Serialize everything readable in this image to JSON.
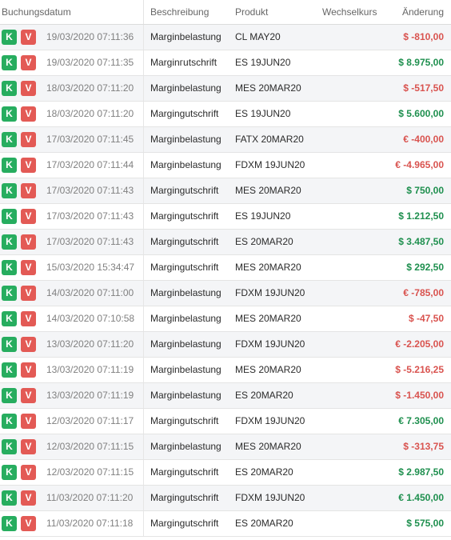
{
  "header": {
    "date": "Buchungsdatum",
    "description": "Beschreibung",
    "product": "Produkt",
    "exchange_rate": "Wechselkurs",
    "change": "Änderung"
  },
  "buttons": {
    "k_label": "K",
    "v_label": "V"
  },
  "colors": {
    "k_button": "#27ad5f",
    "v_button": "#e35a55",
    "negative": "#d9534f",
    "positive": "#1e8f4e"
  },
  "rows": [
    {
      "date": "19/03/2020 07:11:36",
      "description": "Marginbelastung",
      "product": "CL MAY20",
      "rate": "",
      "amount": "$ -810,00",
      "sign": "neg"
    },
    {
      "date": "19/03/2020 07:11:35",
      "description": "Marginгutschrift",
      "product": "ES 19JUN20",
      "rate": "",
      "amount": "$ 8.975,00",
      "sign": "pos"
    },
    {
      "date": "18/03/2020 07:11:20",
      "description": "Marginbelastung",
      "product": "MES 20MAR20",
      "rate": "",
      "amount": "$ -517,50",
      "sign": "neg"
    },
    {
      "date": "18/03/2020 07:11:20",
      "description": "Margingutschrift",
      "product": "ES 19JUN20",
      "rate": "",
      "amount": "$ 5.600,00",
      "sign": "pos"
    },
    {
      "date": "17/03/2020 07:11:45",
      "description": "Marginbelastung",
      "product": "FATX 20MAR20",
      "rate": "",
      "amount": "€ -400,00",
      "sign": "neg"
    },
    {
      "date": "17/03/2020 07:11:44",
      "description": "Marginbelastung",
      "product": "FDXM 19JUN20",
      "rate": "",
      "amount": "€ -4.965,00",
      "sign": "neg"
    },
    {
      "date": "17/03/2020 07:11:43",
      "description": "Margingutschrift",
      "product": "MES 20MAR20",
      "rate": "",
      "amount": "$ 750,00",
      "sign": "pos"
    },
    {
      "date": "17/03/2020 07:11:43",
      "description": "Margingutschrift",
      "product": "ES 19JUN20",
      "rate": "",
      "amount": "$ 1.212,50",
      "sign": "pos"
    },
    {
      "date": "17/03/2020 07:11:43",
      "description": "Margingutschrift",
      "product": "ES 20MAR20",
      "rate": "",
      "amount": "$ 3.487,50",
      "sign": "pos"
    },
    {
      "date": "15/03/2020 15:34:47",
      "description": "Margingutschrift",
      "product": "MES 20MAR20",
      "rate": "",
      "amount": "$ 292,50",
      "sign": "pos"
    },
    {
      "date": "14/03/2020 07:11:00",
      "description": "Marginbelastung",
      "product": "FDXM 19JUN20",
      "rate": "",
      "amount": "€ -785,00",
      "sign": "neg"
    },
    {
      "date": "14/03/2020 07:10:58",
      "description": "Marginbelastung",
      "product": "MES 20MAR20",
      "rate": "",
      "amount": "$ -47,50",
      "sign": "neg"
    },
    {
      "date": "13/03/2020 07:11:20",
      "description": "Marginbelastung",
      "product": "FDXM 19JUN20",
      "rate": "",
      "amount": "€ -2.205,00",
      "sign": "neg"
    },
    {
      "date": "13/03/2020 07:11:19",
      "description": "Marginbelastung",
      "product": "MES 20MAR20",
      "rate": "",
      "amount": "$ -5.216,25",
      "sign": "neg"
    },
    {
      "date": "13/03/2020 07:11:19",
      "description": "Marginbelastung",
      "product": "ES 20MAR20",
      "rate": "",
      "amount": "$ -1.450,00",
      "sign": "neg"
    },
    {
      "date": "12/03/2020 07:11:17",
      "description": "Margingutschrift",
      "product": "FDXM 19JUN20",
      "rate": "",
      "amount": "€ 7.305,00",
      "sign": "pos"
    },
    {
      "date": "12/03/2020 07:11:15",
      "description": "Marginbelastung",
      "product": "MES 20MAR20",
      "rate": "",
      "amount": "$ -313,75",
      "sign": "neg"
    },
    {
      "date": "12/03/2020 07:11:15",
      "description": "Margingutschrift",
      "product": "ES 20MAR20",
      "rate": "",
      "amount": "$ 2.987,50",
      "sign": "pos"
    },
    {
      "date": "11/03/2020 07:11:20",
      "description": "Margingutschrift",
      "product": "FDXM 19JUN20",
      "rate": "",
      "amount": "€ 1.450,00",
      "sign": "pos"
    },
    {
      "date": "11/03/2020 07:11:18",
      "description": "Margingutschrift",
      "product": "ES 20MAR20",
      "rate": "",
      "amount": "$ 575,00",
      "sign": "pos"
    }
  ]
}
